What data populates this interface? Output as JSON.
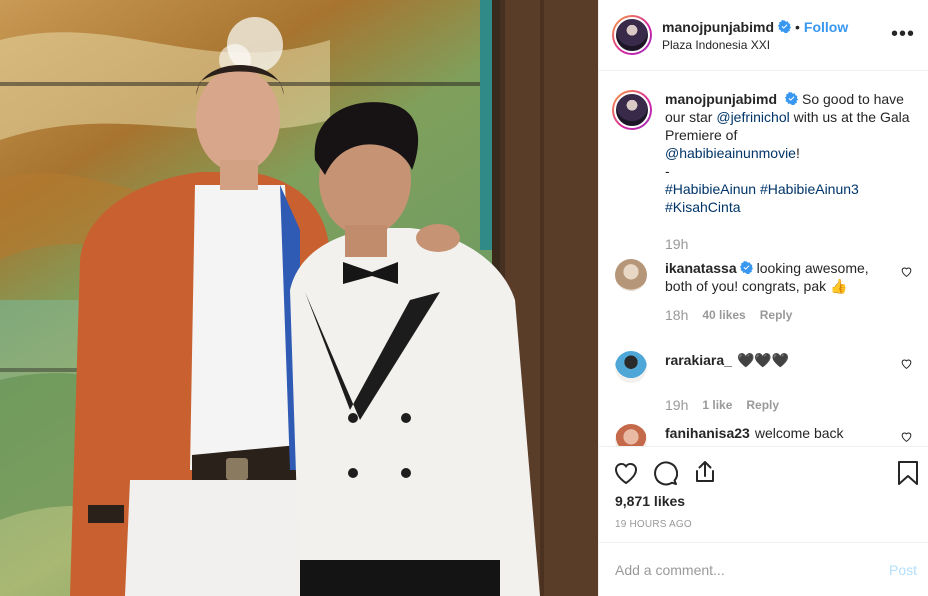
{
  "header": {
    "username": "manojpunjabimd",
    "follow_label": "Follow",
    "location": "Plaza Indonesia XXI",
    "separator": "•"
  },
  "caption": {
    "username": "manojpunjabimd",
    "text_1": "So good to have our star ",
    "mention_1": "@jefrinichol",
    "text_2": " with us at the Gala Premiere of ",
    "mention_2": "@habibieainunmovie",
    "text_3": "!",
    "dash": "-",
    "hashtag_1": "#HabibieAinun",
    "hashtag_2": "#HabibieAinun3",
    "hashtag_3": "#KisahCinta",
    "time": "19h"
  },
  "comments": [
    {
      "username": "ikanatassa",
      "text": "looking awesome, both of you! congrats, pak 👍",
      "time": "18h",
      "likes": "40 likes",
      "reply": "Reply",
      "verified": true
    },
    {
      "username": "rarakiara_",
      "text": "🖤🖤🖤",
      "time": "19h",
      "likes": "1 like",
      "reply": "Reply",
      "verified": false
    },
    {
      "username": "fanihanisa23",
      "text": "welcome back",
      "verified": false
    }
  ],
  "actions": {
    "likes": "9,871 likes",
    "posted_time": "19 hours ago"
  },
  "add_comment": {
    "placeholder": "Add a comment...",
    "post_label": "Post"
  },
  "colors": {
    "accent": "#3897f0",
    "muted": "#999999",
    "border": "#efefef",
    "link": "#003569"
  },
  "icons": [
    "verified-badge-icon",
    "more-options-icon",
    "heart-icon",
    "comment-icon",
    "share-icon",
    "bookmark-icon"
  ]
}
